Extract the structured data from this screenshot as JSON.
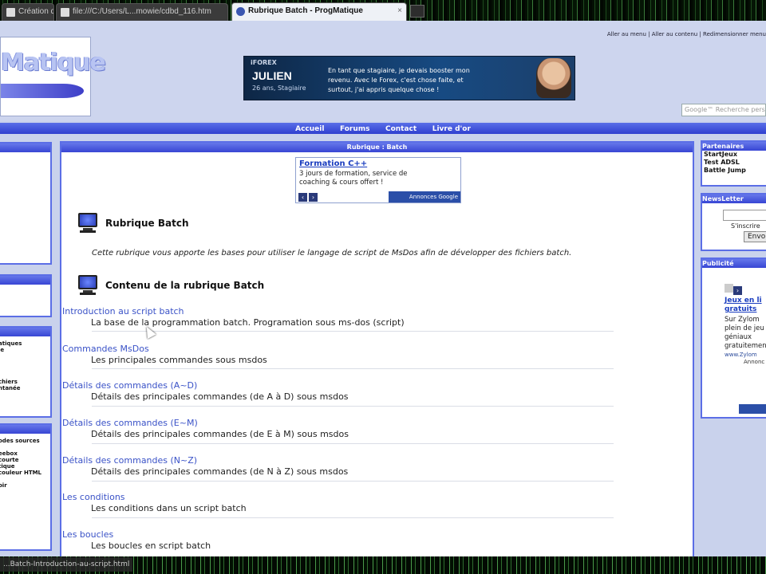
{
  "browser": {
    "tabs": [
      {
        "title": "Création de rép...",
        "active": false
      },
      {
        "title": "file:///C:/Users/L...mowie/cdbd_116.htm",
        "active": false
      },
      {
        "title": "Rubrique Batch - ProgMatique",
        "active": true
      }
    ],
    "status_url": "...Batch-Introduction-au-script.html"
  },
  "header": {
    "logo_text": "Matique",
    "toplinks": "Aller au menu  |  Aller au contenu  |  Redimensionner menu",
    "banner": {
      "brand": "iFOREX",
      "name": "JULIEN",
      "sub": "26 ans, Stagiaire",
      "message": "En tant que stagiaire, je devais booster mon revenu. Avec le Forex, c'est chose faite, et surtout, j'ai appris quelque chose !"
    },
    "search_placeholder": "Google™ Recherche pers"
  },
  "nav": [
    "Accueil",
    "Forums",
    "Contact",
    "Livre d'or"
  ],
  "left": {
    "box3_items": [
      "atiques",
      "le",
      "",
      "",
      "chiers",
      "ntanée"
    ],
    "box4_items": [
      "odes sources",
      "",
      "eebox",
      "courte",
      "tique",
      "couleur HTML",
      "",
      "oir"
    ]
  },
  "main": {
    "caption": "Rubrique : Batch",
    "ad": {
      "title": "Formation C++",
      "desc": "3 jours de formation, service de coaching & cours offert !",
      "footer": "Annonces Google"
    },
    "section1_title": "Rubrique Batch",
    "intro": "Cette rubrique vous apporte les bases pour utiliser le langage de script de MsDos afin de développer des fichiers batch.",
    "section2_title": "Contenu de la rubrique Batch",
    "entries": [
      {
        "link": "Introduction au script batch",
        "desc": "La base de la programmation batch. Programation sous ms-dos (script)"
      },
      {
        "link": "Commandes MsDos",
        "desc": "Les principales commandes sous msdos"
      },
      {
        "link": "Détails des commandes (A~D)",
        "desc": "Détails des principales commandes (de A à D) sous msdos"
      },
      {
        "link": "Détails des commandes (E~M)",
        "desc": "Détails des principales commandes (de E à M) sous msdos"
      },
      {
        "link": "Détails des commandes (N~Z)",
        "desc": "Détails des principales commandes (de N à Z) sous msdos"
      },
      {
        "link": "Les conditions",
        "desc": "Les conditions dans un script batch"
      },
      {
        "link": "Les boucles",
        "desc": "Les boucles en script batch"
      }
    ]
  },
  "right": {
    "partners_caption": "Partenaires",
    "partners": [
      "StartJeux",
      "Test ADSL",
      "Battle Jump"
    ],
    "newsletter_caption": "NewsLetter",
    "newsletter_subscribe": "S'inscrire",
    "newsletter_button": "Envo",
    "pub_caption": "Publicité",
    "pub_link": "Jeux en li gratuits",
    "pub_text": "Sur Zylom plein de jeu géniaux gratuitemen",
    "pub_url": "www.Zylom",
    "pub_footer": "Annonc"
  }
}
